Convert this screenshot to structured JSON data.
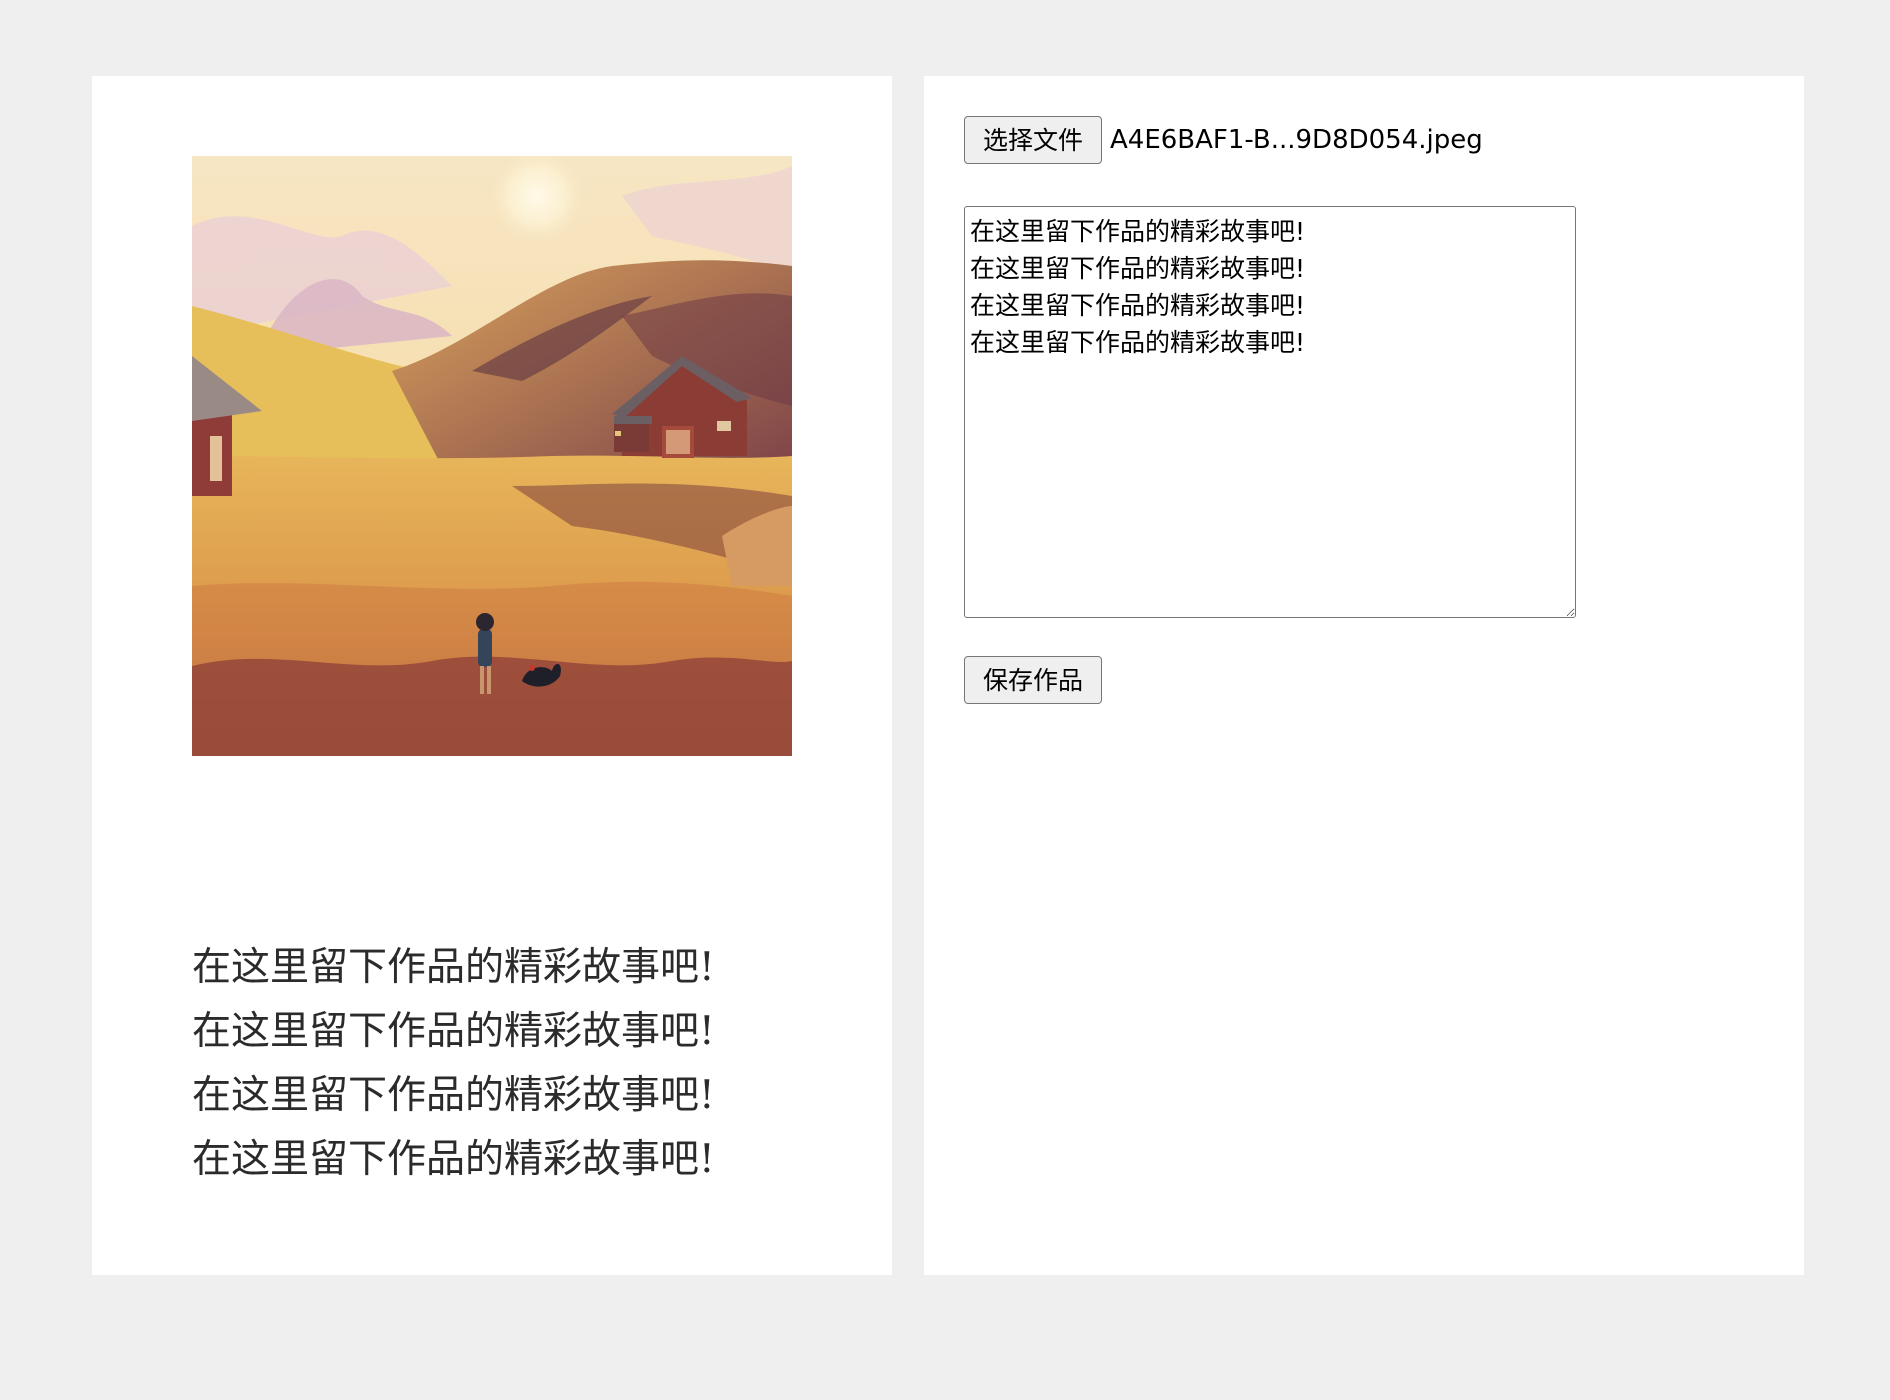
{
  "preview": {
    "artwork_alt": "illustration",
    "story_lines": [
      "在这里留下作品的精彩故事吧!",
      "在这里留下作品的精彩故事吧!",
      "在这里留下作品的精彩故事吧!",
      "在这里留下作品的精彩故事吧!"
    ]
  },
  "editor": {
    "choose_file_label": "选择文件",
    "file_name": "A4E6BAF1-B...9D8D054.jpeg",
    "story_text": "在这里留下作品的精彩故事吧!\n在这里留下作品的精彩故事吧!\n在这里留下作品的精彩故事吧!\n在这里留下作品的精彩故事吧!",
    "save_label": "保存作品"
  }
}
